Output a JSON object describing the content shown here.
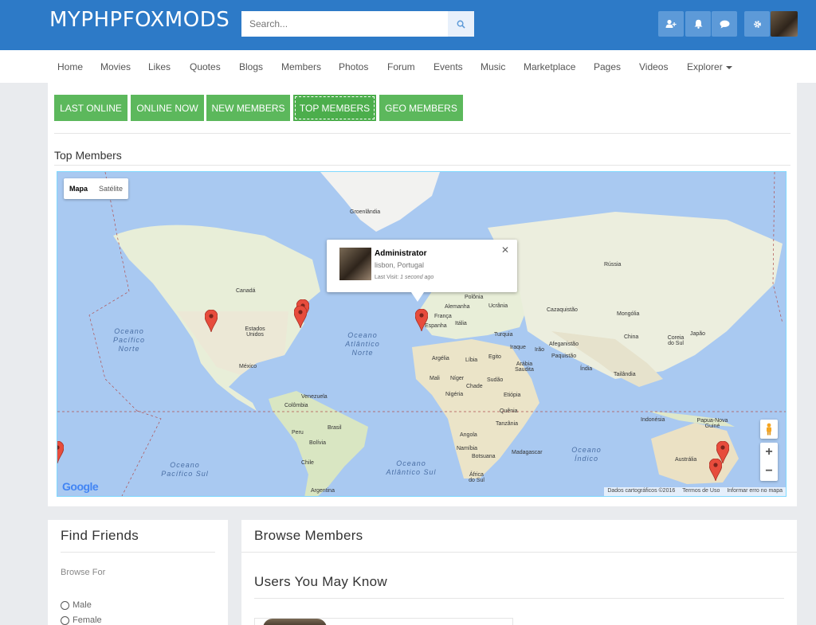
{
  "header": {
    "brand": "MYPHPFOXMODS",
    "search_placeholder": "Search...",
    "icons": [
      "add-user-icon",
      "bell-icon",
      "chat-icon",
      "gear-icon"
    ]
  },
  "nav": {
    "items": [
      "Home",
      "Movies",
      "Likes",
      "Quotes",
      "Blogs",
      "Members",
      "Photos",
      "Forum",
      "Events",
      "Music",
      "Marketplace",
      "Pages",
      "Videos",
      "Explorer"
    ]
  },
  "tabs": [
    "LAST ONLINE",
    "ONLINE NOW",
    "NEW MEMBERS",
    "TOP MEMBERS",
    "GEO MEMBERS"
  ],
  "active_tab": "TOP MEMBERS",
  "section_title": "Top Members",
  "map": {
    "type_buttons": [
      "Mapa",
      "Satélite"
    ],
    "info": {
      "name": "Administrator",
      "location": "lisbon, Portugal",
      "last_visit_label": "Last Visit:",
      "last_visit_value": "1 second ago"
    },
    "labels": [
      "Groenlândia",
      "Canadá",
      "Estados Unidos",
      "México",
      "Venezuela",
      "Colômbia",
      "Peru",
      "Brasil",
      "Bolívia",
      "Chile",
      "Argentina",
      "Rússia",
      "Polônia",
      "Alemanha",
      "Ucrânia",
      "França",
      "Itália",
      "Espanha",
      "Turquia",
      "Cazaquistão",
      "Mongólia",
      "China",
      "Japão",
      "Coreia do Sul",
      "Iraque",
      "Irão",
      "Afeganistão",
      "Paquistão",
      "Índia",
      "Tailândia",
      "Argélia",
      "Líbia",
      "Egito",
      "Arábia Saudita",
      "Mali",
      "Níger",
      "Chade",
      "Sudão",
      "Nigéria",
      "Etiópia",
      "Quênia",
      "Tanzânia",
      "Angola",
      "Namíbia",
      "Botsuana",
      "África do Sul",
      "Madagascar",
      "Indonésia",
      "Papua-Nova Guiné",
      "Austrália"
    ],
    "oceans": [
      "Oceano\nPacífico\nNorte",
      "Oceano\nAtlântico\nNorte",
      "Oceano\nPacífico Sul",
      "Oceano\nAtlântico Sul",
      "Oceano\nÍndico"
    ],
    "attribution": [
      "Dados cartográficos ©2016",
      "Termos de Uso",
      "Informar erro no mapa"
    ],
    "logo": "Google",
    "zoom_in": "+",
    "zoom_out": "−"
  },
  "find_friends": {
    "title": "Find Friends",
    "browse_for": "Browse For",
    "options": [
      "Male",
      "Female"
    ]
  },
  "browse": {
    "title": "Browse Members",
    "subtitle": "Users You May Know"
  },
  "colors": {
    "header_blue": "#2d7ac7",
    "tab_green": "#5cb85c",
    "marker_red": "#e74c3c"
  }
}
